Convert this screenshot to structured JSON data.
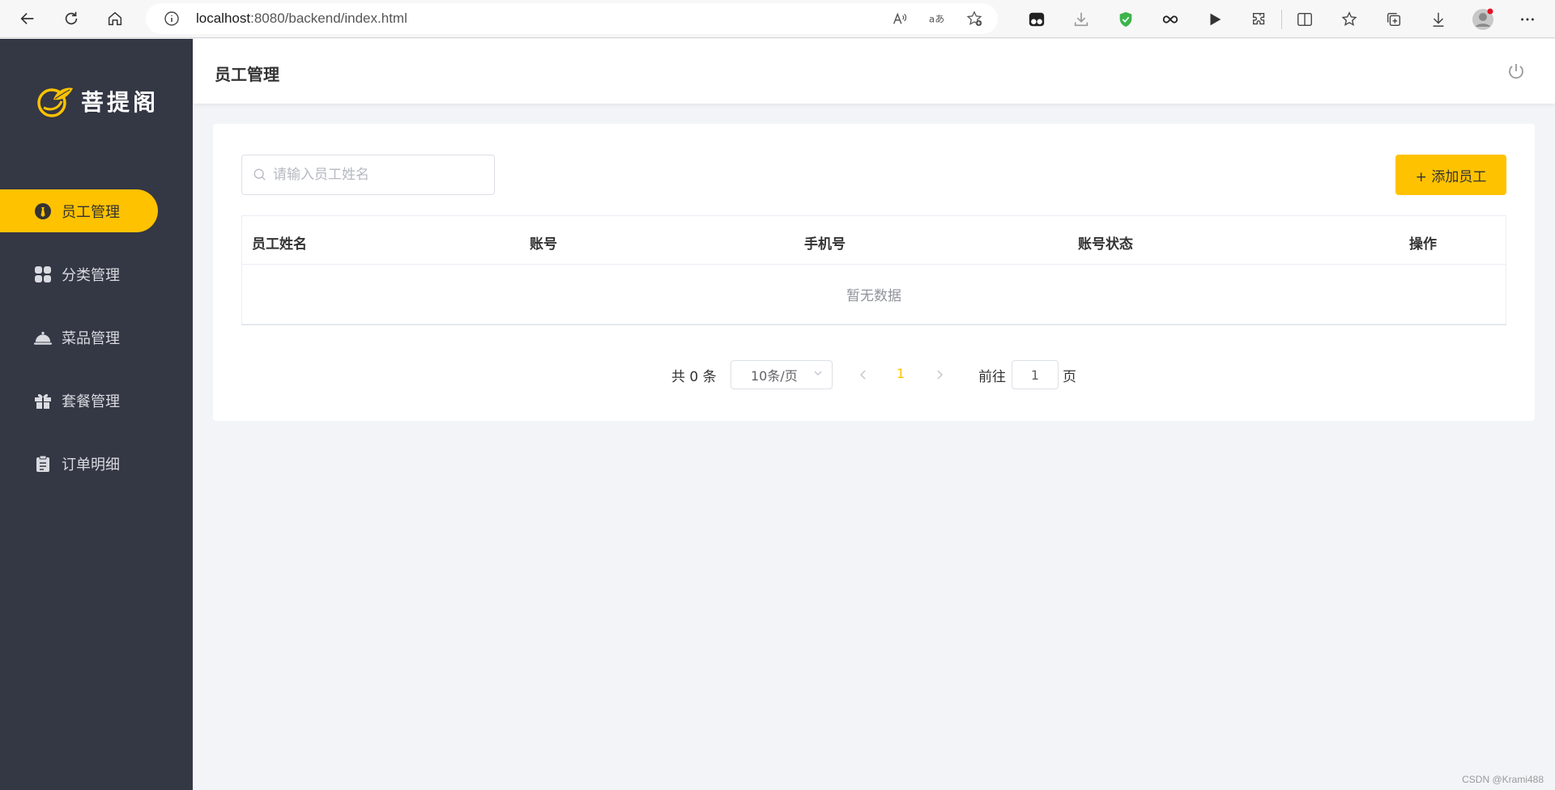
{
  "browser": {
    "url_host": "localhost",
    "url_rest": ":8080/backend/index.html"
  },
  "sidebar": {
    "logo_text": "菩提阁",
    "items": [
      {
        "label": "员工管理",
        "icon": "user-tie-icon",
        "active": true
      },
      {
        "label": "分类管理",
        "icon": "grid-icon",
        "active": false
      },
      {
        "label": "菜品管理",
        "icon": "cloche-icon",
        "active": false
      },
      {
        "label": "套餐管理",
        "icon": "gift-icon",
        "active": false
      },
      {
        "label": "订单明细",
        "icon": "clipboard-icon",
        "active": false
      }
    ]
  },
  "header": {
    "title": "员工管理"
  },
  "main": {
    "search_placeholder": "请输入员工姓名",
    "add_button_label": "+ 添加员工",
    "table": {
      "columns": [
        "员工姓名",
        "账号",
        "手机号",
        "账号状态",
        "操作"
      ],
      "empty_text": "暂无数据"
    },
    "pagination": {
      "total_text": "共 0 条",
      "page_size": "10条/页",
      "current_page": "1",
      "goto_label": "前往",
      "goto_value": "1",
      "page_suffix": "页"
    }
  },
  "watermark": "CSDN @Krami488",
  "colors": {
    "accent": "#ffc200",
    "sidebar_bg": "#343744",
    "page_bg": "#f3f4f7"
  }
}
